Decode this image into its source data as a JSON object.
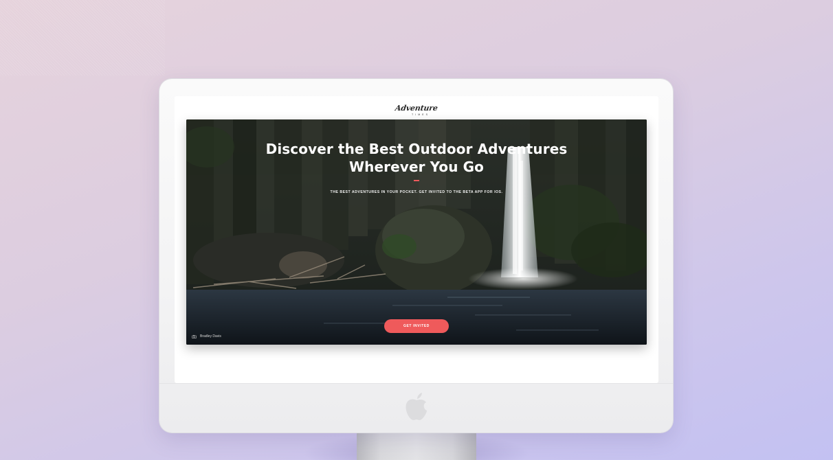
{
  "site": {
    "logo_text": "Adventure",
    "logo_subtext": "TIMES"
  },
  "hero": {
    "title_line1": "Discover the Best Outdoor Adventures",
    "title_line2": "Wherever You Go",
    "subtitle": "THE BEST ADVENTURES IN YOUR POCKET. GET INVITED TO THE BETA APP FOR IOS.",
    "cta_label": "GET INVITED",
    "photo_credit": "Bradley Davis"
  },
  "icons": {
    "credit": "camera-icon",
    "device_brand": "apple-logo-icon"
  },
  "colors": {
    "accent": "#ef5a5b",
    "background_top": "#e6d3dc",
    "background_bottom": "#c3c1f2"
  }
}
